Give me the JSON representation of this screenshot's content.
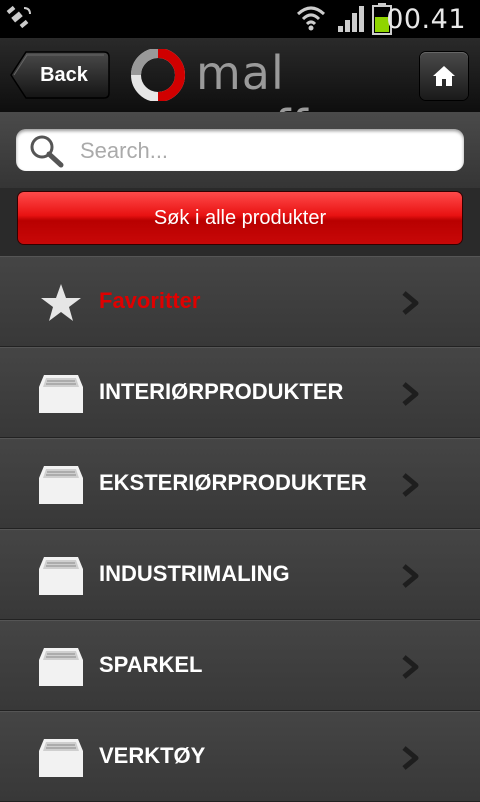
{
  "status": {
    "time": "00.41"
  },
  "header": {
    "back_label": "Back",
    "brand": "mal proff"
  },
  "search": {
    "placeholder": "Search..."
  },
  "search_all": {
    "label": "Søk i alle produkter"
  },
  "colors": {
    "accent_red": "#e00000",
    "background": "#3a3a3a"
  },
  "menu": [
    {
      "label": "Favoritter",
      "icon": "star-icon"
    },
    {
      "label": "INTERIØRPRODUKTER",
      "icon": "drawer-icon"
    },
    {
      "label": "EKSTERIØRPRODUKTER",
      "icon": "drawer-icon"
    },
    {
      "label": "INDUSTRIMALING",
      "icon": "drawer-icon"
    },
    {
      "label": "SPARKEL",
      "icon": "drawer-icon"
    },
    {
      "label": "VERKTØY",
      "icon": "drawer-icon"
    }
  ]
}
